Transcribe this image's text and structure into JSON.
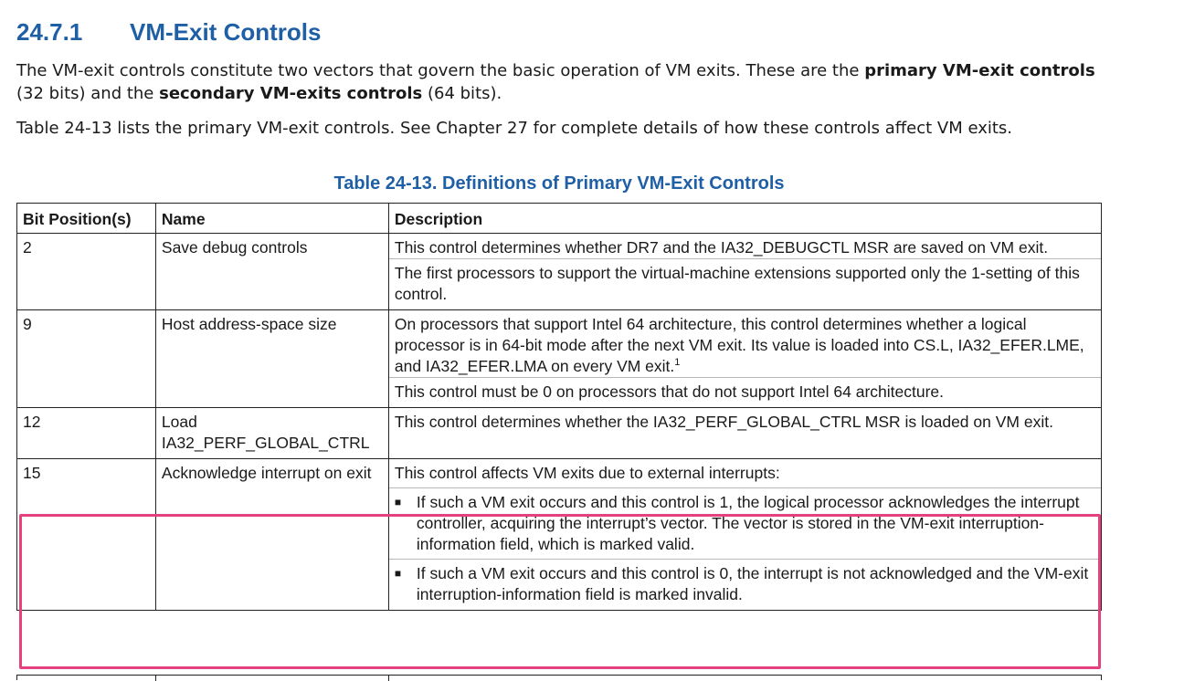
{
  "section": {
    "number": "24.7.1",
    "title": "VM-Exit Controls"
  },
  "intro": {
    "p1_a": "The VM-exit controls constitute two vectors that govern the basic operation of VM exits. These are the ",
    "p1_b1": "primary VM-exit controls",
    "p1_c": " (32 bits) and the ",
    "p1_b2": "secondary VM-exits controls",
    "p1_d": " (64 bits).",
    "p2": "Table 24-13 lists the primary VM-exit controls. See Chapter 27 for complete details of how these controls affect VM exits."
  },
  "table": {
    "caption": "Table 24-13.  Definitions of Primary VM-Exit Controls",
    "headers": [
      "Bit Position(s)",
      "Name",
      "Description"
    ],
    "rows": [
      {
        "bit": "2",
        "name": "Save debug controls",
        "desc": [
          "This control determines whether DR7 and the IA32_DEBUGCTL MSR are saved on VM exit.",
          "The first processors to support the virtual-machine extensions supported only the 1-setting of this control."
        ]
      },
      {
        "bit": "9",
        "name": "Host address-space size",
        "desc": [
          "On processors that support Intel 64 architecture, this control determines whether a logical processor is in 64-bit mode after the next VM exit. Its value is loaded into CS.L, IA32_EFER.LME, and IA32_EFER.LMA on every VM exit.",
          "This control must be 0 on processors that do not support Intel 64 architecture."
        ],
        "footnote_mark": "1"
      },
      {
        "bit": "12",
        "name": "Load IA32_PERF_GLOBAL_CTRL",
        "desc": [
          "This control determines whether the IA32_PERF_GLOBAL_CTRL MSR is loaded on VM exit."
        ]
      },
      {
        "bit": "15",
        "name": "Acknowledge interrupt on exit",
        "desc_intro": "This control affects VM exits due to external interrupts:",
        "bullet_glyph": "■",
        "bullets": [
          "If such a VM exit occurs and this control is 1, the logical processor acknowledges the interrupt controller, acquiring the interrupt’s vector. The vector is stored in the VM-exit interruption-information field, which is marked valid.",
          "If such a VM exit occurs and this control is 0, the interrupt is not acknowledged and the VM-exit interruption-information field is marked invalid."
        ]
      }
    ]
  },
  "colors": {
    "heading": "#1f5fa6",
    "highlight": "#e4417e"
  }
}
